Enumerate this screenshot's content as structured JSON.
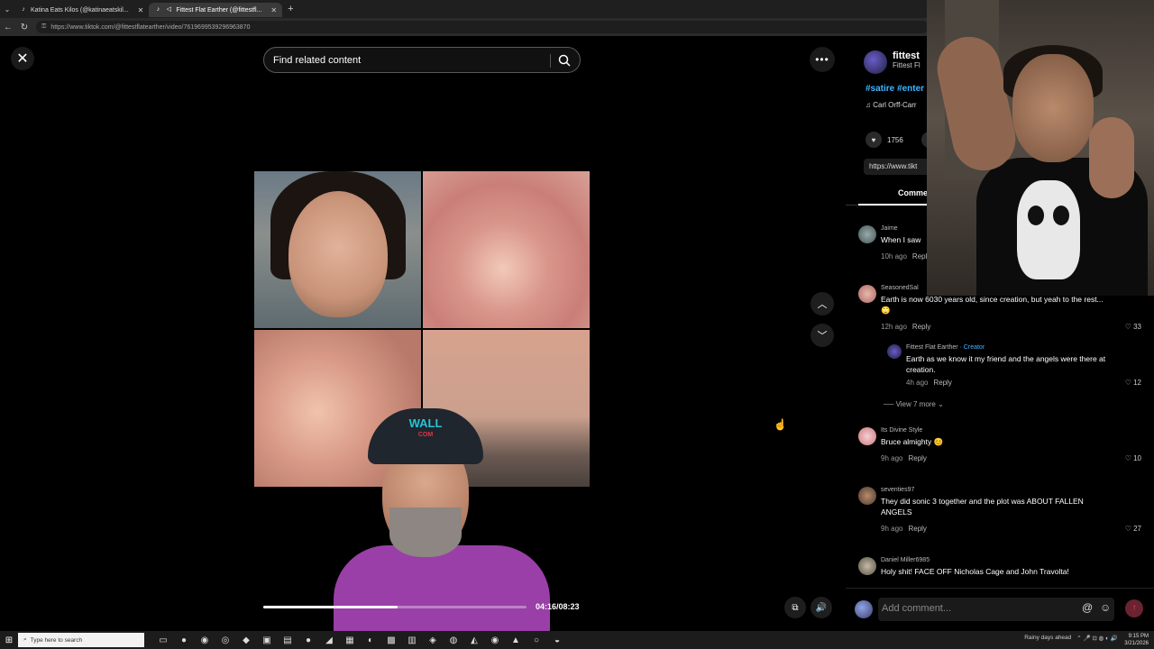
{
  "browser": {
    "tabs": [
      {
        "title": "Katina Eats Kilos (@katinaeatskil...",
        "active": false
      },
      {
        "title": "Fittest Flat Earther (@fittestfl...",
        "active": true
      }
    ],
    "url": "https://www.tiktok.com/@fittestflatearther/video/7619699539296963870"
  },
  "search": {
    "placeholder": "Find related content"
  },
  "video": {
    "time": "04:16/08:23",
    "progress": 0.51,
    "cap_logo_top": "WALL",
    "cap_logo_bottom": "COM"
  },
  "sidebar": {
    "author_name": "fittest",
    "author_sub": "Fittest Fl",
    "tags": "#satire #enter",
    "music": "♫  Carl Orff-Carr",
    "likes": "1756",
    "link": "https://www.tikt",
    "tab_label": "Comme",
    "comments": [
      {
        "user": "Jaime",
        "text": "When I saw",
        "time": "10h ago",
        "reply": "Reply",
        "likes": ""
      },
      {
        "user": "SeasonedSal",
        "text": "Earth is now 6030 years old, since creation, but yeah to the rest... 🙄",
        "time": "12h ago",
        "reply": "Reply",
        "likes": "33"
      },
      {
        "user": "Fittest Flat Earther",
        "creator": "· Creator",
        "text": "Earth as we know it my friend and the angels were there at creation.",
        "time": "4h ago",
        "reply": "Reply",
        "likes": "12"
      },
      {
        "user": "Its Divine Style",
        "text": "Bruce almighty 😊",
        "time": "9h ago",
        "reply": "Reply",
        "likes": "10"
      },
      {
        "user": "seventies97",
        "text": "They did sonic 3 together and the plot was ABOUT FALLEN ANGELS",
        "time": "9h ago",
        "reply": "Reply",
        "likes": "27"
      },
      {
        "user": "Daniel Miller6985",
        "text": "Holy shit! FACE OFF Nicholas Cage and John Travolta!",
        "time": "",
        "reply": "",
        "likes": ""
      }
    ],
    "view_more": "View 7 more",
    "add_comment_placeholder": "Add comment..."
  },
  "taskbar": {
    "search_placeholder": "Type here to search",
    "weather": "Rainy days ahead",
    "time": "9:15 PM",
    "date": "3/21/2026"
  },
  "colors": {
    "accent_blue": "#3fb6ff",
    "cap_logo": "#27c4d6",
    "shirt": "#9a3fa8"
  }
}
